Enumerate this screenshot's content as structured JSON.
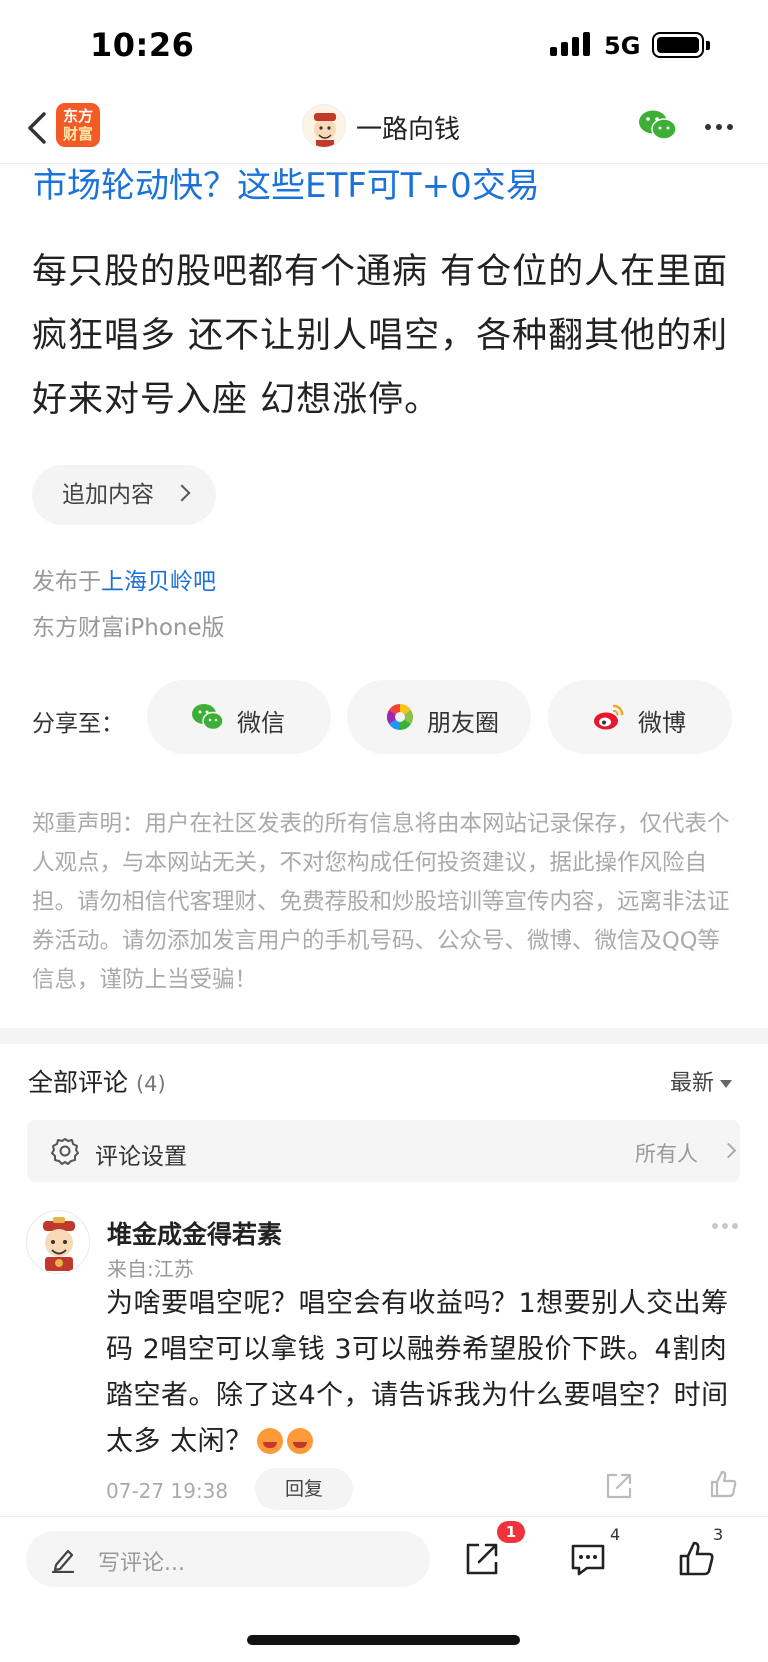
{
  "status_bar": {
    "time": "10:26",
    "network": "5G"
  },
  "nav": {
    "app_logo_line1": "东方",
    "app_logo_line2": "财富",
    "title": "一路向钱"
  },
  "post": {
    "promo_link": "市场轮动快？这些ETF可T+0交易",
    "body": "每只股的股吧都有个通病 有仓位的人在里面疯狂唱多 还不让别人唱空，各种翻其他的利好来对号入座 幻想涨停。",
    "append_label": "追加内容",
    "publish_prefix": "发布于",
    "forum_name": "上海贝岭吧",
    "client": "东方财富iPhone版"
  },
  "share": {
    "label": "分享至：",
    "wechat": "微信",
    "moments": "朋友圈",
    "weibo": "微博"
  },
  "disclaimer": "郑重声明：用户在社区发表的所有信息将由本网站记录保存，仅代表个人观点，与本网站无关，不对您构成任何投资建议，据此操作风险自担。请勿相信代客理财、免费荐股和炒股培训等宣传内容，远离非法证券活动。请勿添加发言用户的手机号码、公众号、微博、微信及QQ等信息，谨防上当受骗！",
  "comments": {
    "title": "全部评论",
    "count": "(4)",
    "sort": "最新",
    "settings_label": "评论设置",
    "settings_value": "所有人",
    "items": [
      {
        "author": "堆金成金得若素",
        "location": "来自:江苏",
        "text": "为啥要唱空呢？唱空会有收益吗？1想要别人交出筹码 2唱空可以拿钱 3可以融券希望股价下跌。4割肉踏空者。除了这4个，请告诉我为什么要唱空？时间太多 太闲？",
        "date": "07-27 19:38",
        "reply_label": "回复"
      }
    ]
  },
  "bottom_bar": {
    "write_placeholder": "写评论...",
    "share_badge": "1",
    "comment_count": "4",
    "like_count": "3"
  },
  "colors": {
    "link_blue": "#1b72d8",
    "brand_orange": "#f35a24",
    "badge_red": "#f0323b",
    "wechat_green": "#3cb034"
  }
}
